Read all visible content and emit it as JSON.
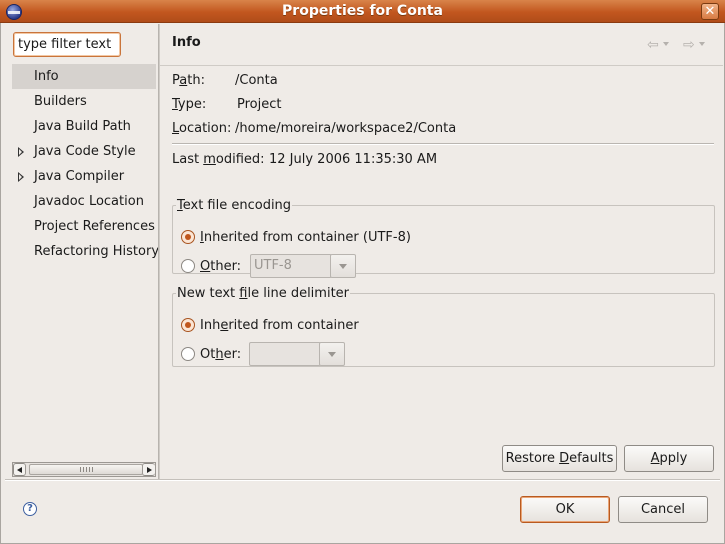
{
  "window": {
    "title": "Properties for Conta",
    "close_glyph": "✕"
  },
  "filter": {
    "placeholder": "type filter text",
    "value": "type filter text"
  },
  "tree": [
    {
      "label": "Info",
      "selected": true,
      "expandable": false
    },
    {
      "label": "Builders",
      "selected": false,
      "expandable": false
    },
    {
      "label": "Java Build Path",
      "selected": false,
      "expandable": false
    },
    {
      "label": "Java Code Style",
      "selected": false,
      "expandable": true
    },
    {
      "label": "Java Compiler",
      "selected": false,
      "expandable": true
    },
    {
      "label": "Javadoc Location",
      "selected": false,
      "expandable": false
    },
    {
      "label": "Project References",
      "selected": false,
      "expandable": false
    },
    {
      "label": "Refactoring History",
      "selected": false,
      "expandable": false
    }
  ],
  "page": {
    "title": "Info",
    "back_glyph": "⇦",
    "forward_glyph": "⇨",
    "path": {
      "label_pre": "P",
      "label_ul": "a",
      "label_post": "th:",
      "value": "/Conta"
    },
    "type": {
      "label_pre": "",
      "label_ul": "T",
      "label_post": "ype:",
      "value": "Project"
    },
    "location": {
      "label_pre": "",
      "label_ul": "L",
      "label_post": "ocation:",
      "value": "/home/moreira/workspace2/Conta"
    },
    "modified": {
      "label_pre": "Last ",
      "label_ul": "m",
      "label_post": "odified:",
      "value": "12 July 2006 11:35:30 AM"
    }
  },
  "encoding": {
    "legend_pre": "",
    "legend_ul": "T",
    "legend_post": "ext file encoding",
    "inherited_pre": "",
    "inherited_ul": "I",
    "inherited_post": "nherited from container (UTF-8)",
    "other_pre": "",
    "other_ul": "O",
    "other_post": "ther:",
    "other_value": "UTF-8"
  },
  "delimiter": {
    "legend_pre": "New text ",
    "legend_ul": "f",
    "legend_post": "ile line delimiter",
    "inherited_pre": "Inh",
    "inherited_ul": "e",
    "inherited_post": "rited from container",
    "other_pre": "Ot",
    "other_ul": "h",
    "other_post": "er:",
    "other_value": ""
  },
  "buttons": {
    "restore_pre": "Restore ",
    "restore_ul": "D",
    "restore_post": "efaults",
    "apply_pre": "",
    "apply_ul": "A",
    "apply_post": "pply",
    "ok": "OK",
    "cancel": "Cancel",
    "help_glyph": "?"
  },
  "colors": {
    "titlebar": "#c2571f",
    "accent": "#c0561c",
    "background": "#efebe7"
  }
}
